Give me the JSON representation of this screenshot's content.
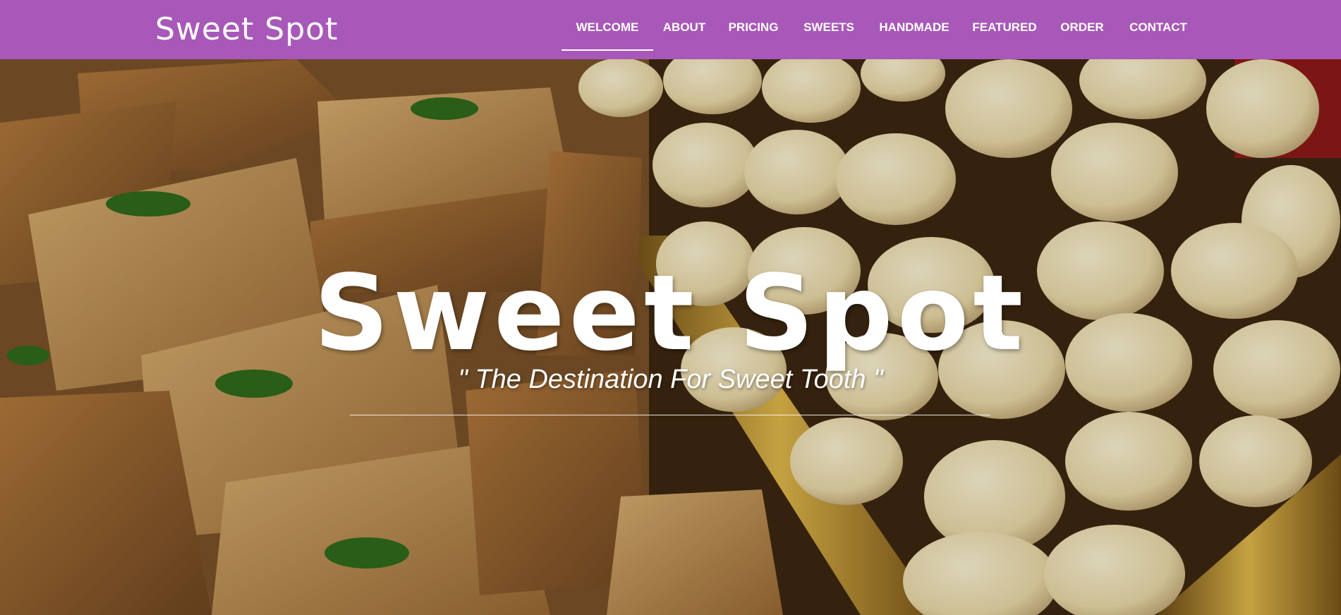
{
  "brand": {
    "name": "Sweet Spot"
  },
  "nav": {
    "items": [
      {
        "label": "WELCOME",
        "active": true
      },
      {
        "label": "ABOUT",
        "active": false
      },
      {
        "label": "PRICING",
        "active": false
      },
      {
        "label": "SWEETS",
        "active": false
      },
      {
        "label": "HANDMADE",
        "active": false
      },
      {
        "label": "FEATURED",
        "active": false
      },
      {
        "label": "ORDER",
        "active": false
      },
      {
        "label": "CONTACT",
        "active": false
      }
    ]
  },
  "hero": {
    "title": "Sweet Spot",
    "tagline": "\" The Destination For Sweet Tooth \"",
    "background_image": "sweets-photo"
  },
  "colors": {
    "navbar": "#a858b8",
    "text": "#ffffff",
    "barfi": "#c79a5a",
    "peda": "#efe2b8",
    "tray_gold": "#c59a2c"
  }
}
